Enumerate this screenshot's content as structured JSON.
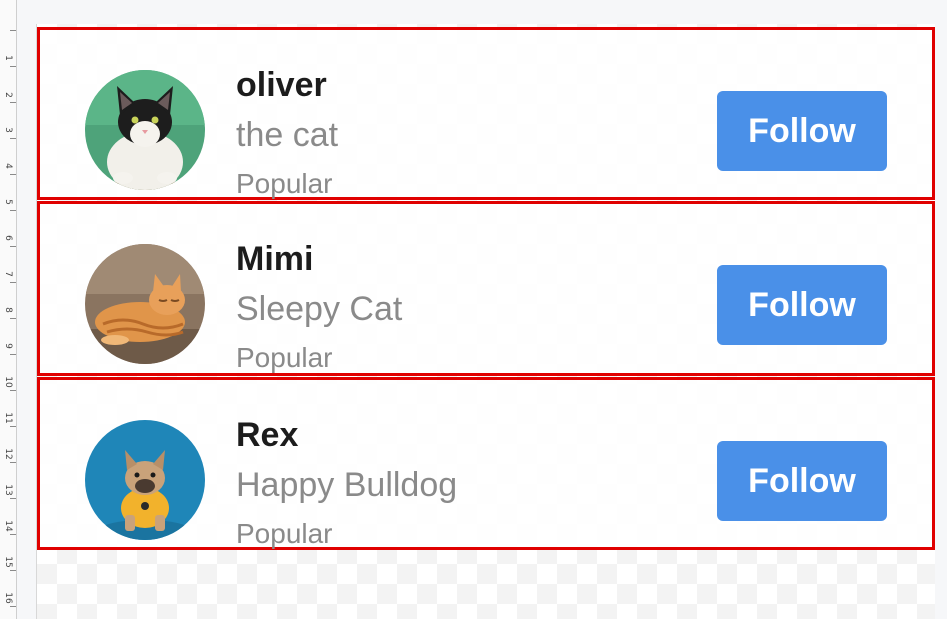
{
  "users": [
    {
      "name": "oliver",
      "subtitle": "the cat",
      "tag": "Popular",
      "follow_label": "Follow",
      "avatar_icon": "cat-photo-avatar"
    },
    {
      "name": "Mimi",
      "subtitle": "Sleepy Cat",
      "tag": "Popular",
      "follow_label": "Follow",
      "avatar_icon": "sleeping-cat-photo-avatar"
    },
    {
      "name": "Rex",
      "subtitle": "Happy Bulldog",
      "tag": "Popular",
      "follow_label": "Follow",
      "avatar_icon": "bulldog-photo-avatar"
    }
  ],
  "ruler": {
    "labels": [
      "1",
      "2",
      "3",
      "4",
      "5",
      "6",
      "7",
      "8",
      "9",
      "10",
      "11",
      "12",
      "13",
      "14",
      "15",
      "16"
    ]
  },
  "colors": {
    "button": "#4a90e8",
    "highlight_border": "#e00000",
    "name_text": "#1c1c1c",
    "muted_text": "#8a8a8a"
  }
}
